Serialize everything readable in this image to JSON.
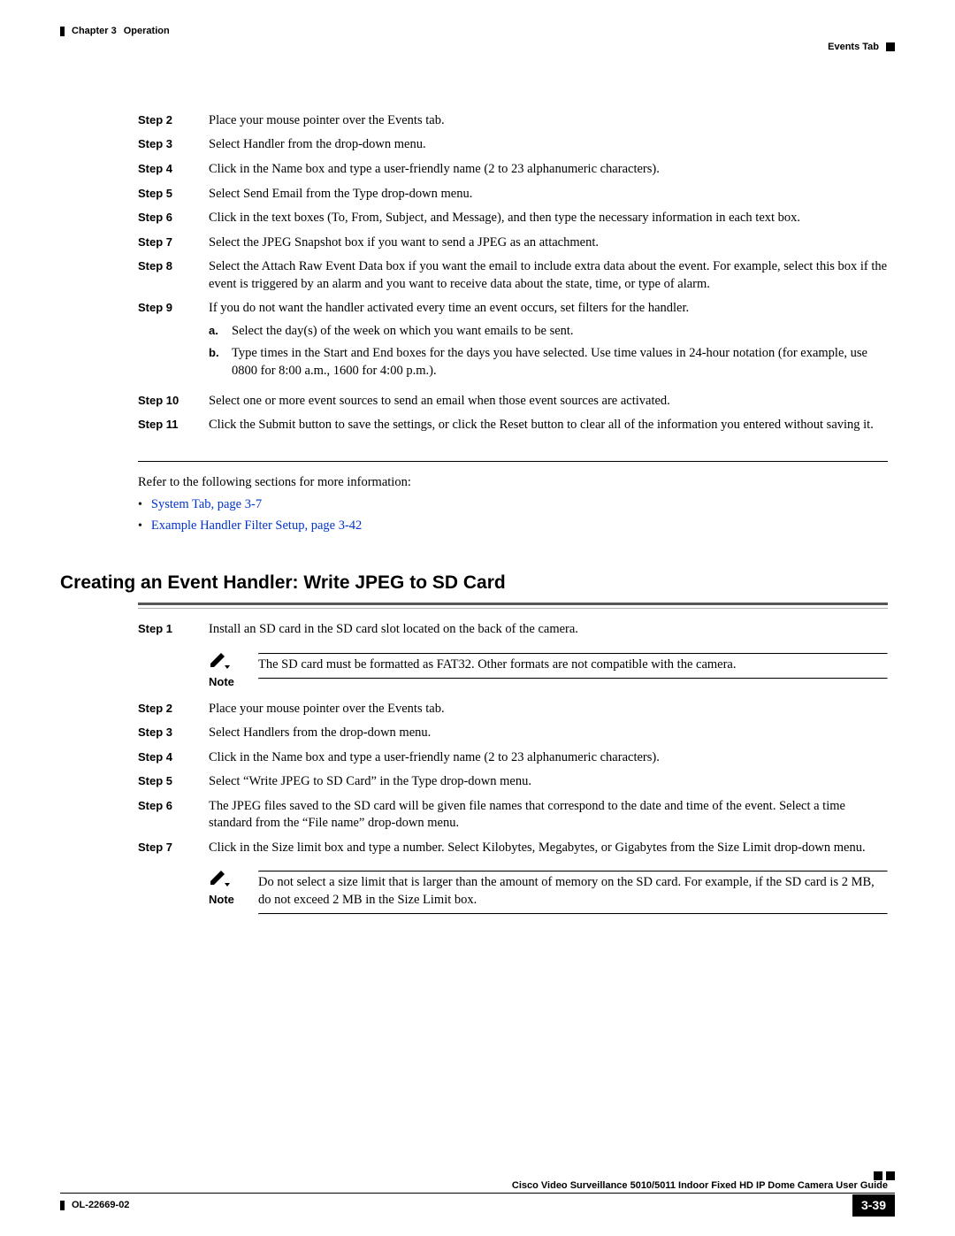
{
  "header": {
    "chapter": "Chapter 3",
    "title": "Operation",
    "section": "Events Tab"
  },
  "steps1": [
    {
      "label": "Step 2",
      "text": "Place your mouse pointer over the Events tab."
    },
    {
      "label": "Step 3",
      "text": "Select Handler from the drop-down menu."
    },
    {
      "label": "Step 4",
      "text": "Click in the Name box and type a user-friendly name (2 to 23 alphanumeric characters)."
    },
    {
      "label": "Step 5",
      "text": "Select Send Email from the Type drop-down menu."
    },
    {
      "label": "Step 6",
      "text": "Click in the text boxes (To, From, Subject, and Message), and then type the necessary information in each text box."
    },
    {
      "label": "Step 7",
      "text": "Select the JPEG Snapshot box if you want to send a JPEG as an attachment."
    },
    {
      "label": "Step 8",
      "text": "Select the Attach Raw Event Data box if you want the email to include extra data about the event. For example, select this box if the event is triggered by an alarm and you want to receive data about the state, time, or type of alarm."
    },
    {
      "label": "Step 9",
      "text": "If you do not want the handler activated every time an event occurs, set filters for the handler.",
      "subs": [
        {
          "letter": "a.",
          "text": "Select the day(s) of the week on which you want emails to be sent."
        },
        {
          "letter": "b.",
          "text": "Type times in the Start and End boxes for the days you have selected. Use time values in 24-hour notation (for example, use 0800 for 8:00 a.m., 1600 for 4:00 p.m.)."
        }
      ]
    },
    {
      "label": "Step 10",
      "text": "Select one or more event sources to send an email when those event sources are activated."
    },
    {
      "label": "Step 11",
      "text": "Click the Submit button to save the settings, or click the Reset button to clear all of the information you entered without saving it."
    }
  ],
  "refer_intro": "Refer to the following sections for more information:",
  "refer_links": [
    "System Tab, page 3-7",
    "Example Handler Filter Setup, page 3-42"
  ],
  "heading2": "Creating an Event Handler: Write JPEG to SD Card",
  "steps2a": [
    {
      "label": "Step 1",
      "text": "Install an SD card in the SD card slot located on the back of the camera."
    }
  ],
  "note1": {
    "label": "Note",
    "text": "The SD card must be formatted as FAT32. Other formats are not compatible with the camera."
  },
  "steps2b": [
    {
      "label": "Step 2",
      "text": "Place your mouse pointer over the Events tab."
    },
    {
      "label": "Step 3",
      "text": "Select Handlers from the drop-down menu."
    },
    {
      "label": "Step 4",
      "text": "Click in the Name box and type a user-friendly name (2 to 23 alphanumeric characters)."
    },
    {
      "label": "Step 5",
      "text": "Select “Write JPEG to SD Card” in the Type drop-down menu."
    },
    {
      "label": "Step 6",
      "text": "The JPEG files saved to the SD card will be given file names that correspond to the date and time of the event. Select a time standard from the “File name” drop-down menu."
    },
    {
      "label": "Step 7",
      "text": "Click in the Size limit box and type a number. Select Kilobytes, Megabytes, or Gigabytes from the Size Limit drop-down menu."
    }
  ],
  "note2": {
    "label": "Note",
    "text": "Do not select a size limit that is larger than the amount of memory on the SD card. For example, if the SD card is 2 MB, do not exceed 2 MB in the Size Limit box."
  },
  "footer": {
    "book": "Cisco Video Surveillance 5010/5011 Indoor Fixed HD IP Dome Camera User Guide",
    "doc_id": "OL-22669-02",
    "page": "3-39"
  }
}
